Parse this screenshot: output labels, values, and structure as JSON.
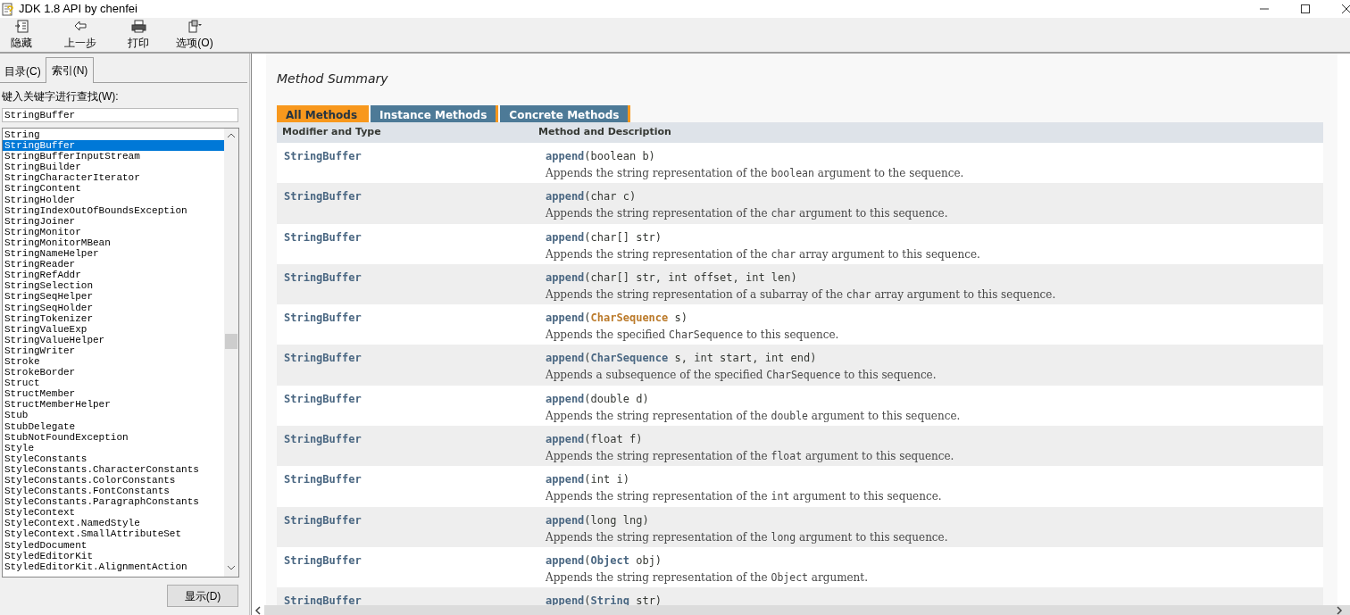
{
  "window": {
    "title": "JDK 1.8 API by chenfei"
  },
  "toolbar": [
    {
      "kind": "hide",
      "label": "隐藏"
    },
    {
      "kind": "back",
      "label": "上一步"
    },
    {
      "kind": "print",
      "label": "打印"
    },
    {
      "kind": "options",
      "label": "选项(O)"
    }
  ],
  "nav_tabs": [
    {
      "label": "目录(C)",
      "selected": false
    },
    {
      "label": "索引(N)",
      "selected": true
    }
  ],
  "search": {
    "label": "键入关键字进行查找(W):",
    "value": "StringBuffer"
  },
  "index_items": [
    {
      "text": "String",
      "selected": false
    },
    {
      "text": "StringBuffer",
      "selected": true
    },
    {
      "text": "StringBufferInputStream",
      "selected": false
    },
    {
      "text": "StringBuilder",
      "selected": false
    },
    {
      "text": "StringCharacterIterator",
      "selected": false
    },
    {
      "text": "StringContent",
      "selected": false
    },
    {
      "text": "StringHolder",
      "selected": false
    },
    {
      "text": "StringIndexOutOfBoundsException",
      "selected": false
    },
    {
      "text": "StringJoiner",
      "selected": false
    },
    {
      "text": "StringMonitor",
      "selected": false
    },
    {
      "text": "StringMonitorMBean",
      "selected": false
    },
    {
      "text": "StringNameHelper",
      "selected": false
    },
    {
      "text": "StringReader",
      "selected": false
    },
    {
      "text": "StringRefAddr",
      "selected": false
    },
    {
      "text": "StringSelection",
      "selected": false
    },
    {
      "text": "StringSeqHelper",
      "selected": false
    },
    {
      "text": "StringSeqHolder",
      "selected": false
    },
    {
      "text": "StringTokenizer",
      "selected": false
    },
    {
      "text": "StringValueExp",
      "selected": false
    },
    {
      "text": "StringValueHelper",
      "selected": false
    },
    {
      "text": "StringWriter",
      "selected": false
    },
    {
      "text": "Stroke",
      "selected": false
    },
    {
      "text": "StrokeBorder",
      "selected": false
    },
    {
      "text": "Struct",
      "selected": false
    },
    {
      "text": "StructMember",
      "selected": false
    },
    {
      "text": "StructMemberHelper",
      "selected": false
    },
    {
      "text": "Stub",
      "selected": false
    },
    {
      "text": "StubDelegate",
      "selected": false
    },
    {
      "text": "StubNotFoundException",
      "selected": false
    },
    {
      "text": "Style",
      "selected": false
    },
    {
      "text": "StyleConstants",
      "selected": false
    },
    {
      "text": "StyleConstants.CharacterConstants",
      "selected": false
    },
    {
      "text": "StyleConstants.ColorConstants",
      "selected": false
    },
    {
      "text": "StyleConstants.FontConstants",
      "selected": false
    },
    {
      "text": "StyleConstants.ParagraphConstants",
      "selected": false
    },
    {
      "text": "StyleContext",
      "selected": false
    },
    {
      "text": "StyleContext.NamedStyle",
      "selected": false
    },
    {
      "text": "StyleContext.SmallAttributeSet",
      "selected": false
    },
    {
      "text": "StyledDocument",
      "selected": false
    },
    {
      "text": "StyledEditorKit",
      "selected": false
    },
    {
      "text": "StyledEditorKit.AlignmentAction",
      "selected": false
    }
  ],
  "display_button": "显示(D)",
  "content": {
    "heading": "Method Summary",
    "method_tabs": [
      {
        "label": "All Methods",
        "selected": true
      },
      {
        "label": "Instance Methods",
        "selected": false
      },
      {
        "label": "Concrete Methods",
        "selected": false
      }
    ],
    "columns": [
      "Modifier and Type",
      "Method and Description"
    ],
    "rows": [
      {
        "type": "StringBuffer",
        "method": [
          {
            "text": "append",
            "kind": "link"
          },
          {
            "text": "(boolean b)",
            "kind": "plain"
          }
        ],
        "description": [
          {
            "text": "Appends the string representation of the ",
            "kind": "text"
          },
          {
            "text": "boolean",
            "kind": "code"
          },
          {
            "text": " argument to the sequence.",
            "kind": "text"
          }
        ]
      },
      {
        "type": "StringBuffer",
        "method": [
          {
            "text": "append",
            "kind": "link"
          },
          {
            "text": "(char c)",
            "kind": "plain"
          }
        ],
        "description": [
          {
            "text": "Appends the string representation of the ",
            "kind": "text"
          },
          {
            "text": "char",
            "kind": "code"
          },
          {
            "text": " argument to this sequence.",
            "kind": "text"
          }
        ]
      },
      {
        "type": "StringBuffer",
        "method": [
          {
            "text": "append",
            "kind": "link"
          },
          {
            "text": "(char[] str)",
            "kind": "plain"
          }
        ],
        "description": [
          {
            "text": "Appends the string representation of the ",
            "kind": "text"
          },
          {
            "text": "char",
            "kind": "code"
          },
          {
            "text": " array argument to this sequence.",
            "kind": "text"
          }
        ]
      },
      {
        "type": "StringBuffer",
        "method": [
          {
            "text": "append",
            "kind": "link"
          },
          {
            "text": "(char[] str, int offset, int len)",
            "kind": "plain"
          }
        ],
        "description": [
          {
            "text": "Appends the string representation of a subarray of the ",
            "kind": "text"
          },
          {
            "text": "char",
            "kind": "code"
          },
          {
            "text": " array argument to this sequence.",
            "kind": "text"
          }
        ]
      },
      {
        "type": "StringBuffer",
        "method": [
          {
            "text": "append",
            "kind": "link"
          },
          {
            "text": "(",
            "kind": "plain"
          },
          {
            "text": "CharSequence",
            "kind": "hover"
          },
          {
            "text": " s)",
            "kind": "plain"
          }
        ],
        "description": [
          {
            "text": "Appends the specified ",
            "kind": "text"
          },
          {
            "text": "CharSequence",
            "kind": "code"
          },
          {
            "text": " to this sequence.",
            "kind": "text"
          }
        ]
      },
      {
        "type": "StringBuffer",
        "method": [
          {
            "text": "append",
            "kind": "link"
          },
          {
            "text": "(",
            "kind": "plain"
          },
          {
            "text": "CharSequence",
            "kind": "link"
          },
          {
            "text": " s, int start, int end)",
            "kind": "plain"
          }
        ],
        "description": [
          {
            "text": "Appends a subsequence of the specified ",
            "kind": "text"
          },
          {
            "text": "CharSequence",
            "kind": "code"
          },
          {
            "text": " to this sequence.",
            "kind": "text"
          }
        ]
      },
      {
        "type": "StringBuffer",
        "method": [
          {
            "text": "append",
            "kind": "link"
          },
          {
            "text": "(double d)",
            "kind": "plain"
          }
        ],
        "description": [
          {
            "text": "Appends the string representation of the ",
            "kind": "text"
          },
          {
            "text": "double",
            "kind": "code"
          },
          {
            "text": " argument to this sequence.",
            "kind": "text"
          }
        ]
      },
      {
        "type": "StringBuffer",
        "method": [
          {
            "text": "append",
            "kind": "link"
          },
          {
            "text": "(float f)",
            "kind": "plain"
          }
        ],
        "description": [
          {
            "text": "Appends the string representation of the ",
            "kind": "text"
          },
          {
            "text": "float",
            "kind": "code"
          },
          {
            "text": " argument to this sequence.",
            "kind": "text"
          }
        ]
      },
      {
        "type": "StringBuffer",
        "method": [
          {
            "text": "append",
            "kind": "link"
          },
          {
            "text": "(int i)",
            "kind": "plain"
          }
        ],
        "description": [
          {
            "text": "Appends the string representation of the ",
            "kind": "text"
          },
          {
            "text": "int",
            "kind": "code"
          },
          {
            "text": " argument to this sequence.",
            "kind": "text"
          }
        ]
      },
      {
        "type": "StringBuffer",
        "method": [
          {
            "text": "append",
            "kind": "link"
          },
          {
            "text": "(long lng)",
            "kind": "plain"
          }
        ],
        "description": [
          {
            "text": "Appends the string representation of the ",
            "kind": "text"
          },
          {
            "text": "long",
            "kind": "code"
          },
          {
            "text": " argument to this sequence.",
            "kind": "text"
          }
        ]
      },
      {
        "type": "StringBuffer",
        "method": [
          {
            "text": "append",
            "kind": "link"
          },
          {
            "text": "(",
            "kind": "plain"
          },
          {
            "text": "Object",
            "kind": "link"
          },
          {
            "text": " obj)",
            "kind": "plain"
          }
        ],
        "description": [
          {
            "text": "Appends the string representation of the ",
            "kind": "text"
          },
          {
            "text": "Object",
            "kind": "code"
          },
          {
            "text": " argument.",
            "kind": "text"
          }
        ]
      },
      {
        "type": "StringBuffer",
        "method": [
          {
            "text": "append",
            "kind": "link"
          },
          {
            "text": "(",
            "kind": "plain"
          },
          {
            "text": "String",
            "kind": "link"
          },
          {
            "text": " str)",
            "kind": "plain"
          }
        ]
      }
    ]
  }
}
